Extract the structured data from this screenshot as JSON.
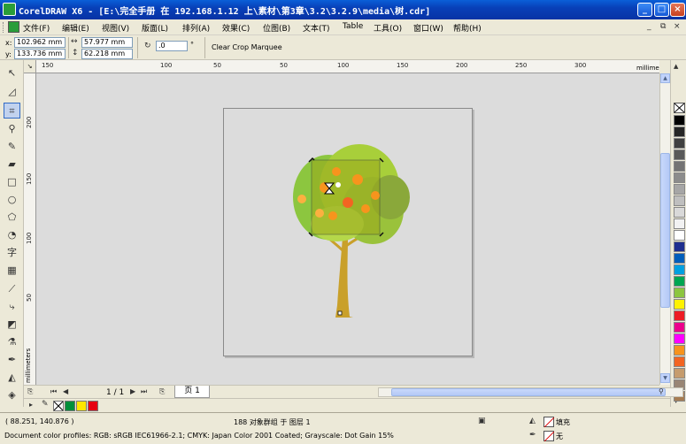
{
  "window": {
    "title": "CorelDRAW X6 - [E:\\完全手册 在 192.168.1.12 上\\素材\\第3章\\3.2\\3.2.9\\media\\树.cdr]",
    "minimize": "_",
    "maximize": "□",
    "close": "×"
  },
  "menu": {
    "items": [
      "文件(F)",
      "编辑(E)",
      "视图(V)",
      "版面(L)",
      "排列(A)",
      "效果(C)",
      "位图(B)",
      "文本(T)",
      "Table",
      "工具(O)",
      "窗口(W)",
      "帮助(H)"
    ],
    "mdi": [
      "_",
      "⧉",
      "×"
    ]
  },
  "propbar": {
    "x_label": "x:",
    "x_value": "102.962 mm",
    "y_label": "y:",
    "y_value": "133.736 mm",
    "w_value": "57.977 mm",
    "h_value": "62.218 mm",
    "rotate_value": ".0",
    "rotate_unit": "°",
    "clear_crop": "Clear Crop Marquee"
  },
  "rulers": {
    "units": "millimeters",
    "h_ticks": [
      "150",
      "100",
      "50",
      "0",
      "50",
      "100",
      "150",
      "200",
      "250",
      "300"
    ],
    "v_ticks": [
      "200",
      "150",
      "100",
      "50",
      "0"
    ]
  },
  "pagenav": {
    "page_count": "1 / 1",
    "page_tab": "页 1"
  },
  "status": {
    "cursor": "( 88.251, 140.876 )",
    "object_info": "188 对象群组 于 图层 1",
    "profiles": "Document color profiles: RGB: sRGB IEC61966-2.1; CMYK: Japan Color 2001 Coated; Grayscale: Dot Gain 15%",
    "fill": "填充",
    "outline": "无"
  },
  "palette_colors": [
    "#000000",
    "#262626",
    "#404040",
    "#595959",
    "#737373",
    "#8c8c8c",
    "#a6a6a6",
    "#bfbfbf",
    "#d9d9d9",
    "#f2f2f2",
    "#ffffff",
    "#1f2f8f",
    "#005ebb",
    "#00a0e0",
    "#00a651",
    "#8dc63f",
    "#fff200",
    "#ed1c24",
    "#ec008c",
    "#ff00ff",
    "#f7941d",
    "#f26522",
    "#c69c6d",
    "#998675",
    "#a67c52"
  ],
  "doc_palette_colors": [
    "#008f3a",
    "#ffe600",
    "#e60012"
  ]
}
